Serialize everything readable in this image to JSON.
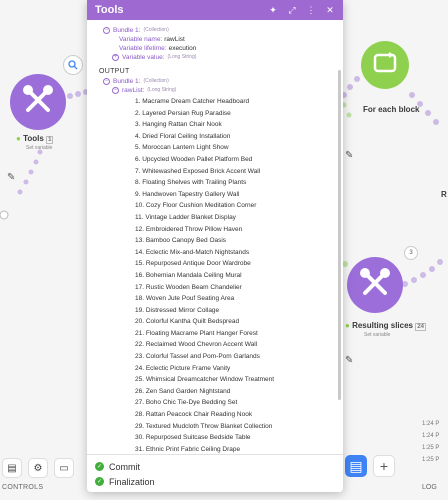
{
  "canvas": {
    "tools_module": {
      "label": "Tools",
      "badge": "1",
      "sub": "Set variable"
    },
    "iterator_module": {
      "label": "For each block"
    },
    "slices_module": {
      "label": "Resulting slices",
      "badge": "24",
      "sub": "Set variable"
    },
    "count_badge": "3",
    "partial_label": "R",
    "controls_label": "CONTROLS",
    "log_label": "LOG",
    "log_times": [
      "1:24 P",
      "1:24 P",
      "1:25 P",
      "1:25 P"
    ],
    "colors": {
      "tools": "#9b6ed9",
      "iterator": "#8fd14f",
      "accent": "#9e6ad2"
    }
  },
  "modal": {
    "title": "Tools",
    "input": {
      "bundle_label": "Bundle 1:",
      "bundle_type": "(Collection)",
      "variable_name_key": "Variable name:",
      "variable_name_value": "rawList",
      "variable_lifetime_key": "Variable lifetime:",
      "variable_lifetime_value": "execution",
      "variable_value_key": "Variable value:",
      "variable_value_type": "(Long String)"
    },
    "output_heading": "OUTPUT",
    "output": {
      "bundle_label": "Bundle 1:",
      "bundle_type": "(Collection)",
      "key": "rawList:",
      "key_type": "(Long String)",
      "items": [
        "1. Macrame Dream Catcher Headboard",
        "2. Layered Persian Rug Paradise",
        "3. Hanging Rattan Chair Nook",
        "4. Dried Floral Ceiling Installation",
        "5. Moroccan Lantern Light Show",
        "6. Upcycled Wooden Pallet Platform Bed",
        "7. Whitewashed Exposed Brick Accent Wall",
        "8. Floating Shelves with Trailing Plants",
        "9. Handwoven Tapestry Gallery Wall",
        "10. Cozy Floor Cushion Meditation Corner",
        "11. Vintage Ladder Blanket Display",
        "12. Embroidered Throw Pillow Haven",
        "13. Bamboo Canopy Bed Oasis",
        "14. Eclectic Mix-and-Match Nightstands",
        "15. Repurposed Antique Door Wardrobe",
        "16. Bohemian Mandala Ceiling Mural",
        "17. Rustic Wooden Beam Chandelier",
        "18. Woven Jute Pouf Seating Area",
        "19. Distressed Mirror Collage",
        "20. Colorful Kantha Quilt Bedspread",
        "21. Floating Macrame Plant Hanger Forest",
        "22. Reclaimed Wood Chevron Accent Wall",
        "23. Colorful Tassel and Pom-Pom Garlands",
        "24. Eclectic Picture Frame Vanity",
        "25. Whimsical Dreamcatcher Window Treatment",
        "26. Zen Sand Garden Nightstand",
        "27. Boho Chic Tie-Dye Bedding Set",
        "28. Rattan Peacock Chair Reading Nook",
        "29. Textured Mudcloth Throw Blanket Collection",
        "30. Repurposed Suitcase Bedside Table",
        "31. Ethnic Print Fabric Ceiling Drape"
      ]
    },
    "footer": {
      "commit": "Commit",
      "finalization": "Finalization"
    }
  }
}
